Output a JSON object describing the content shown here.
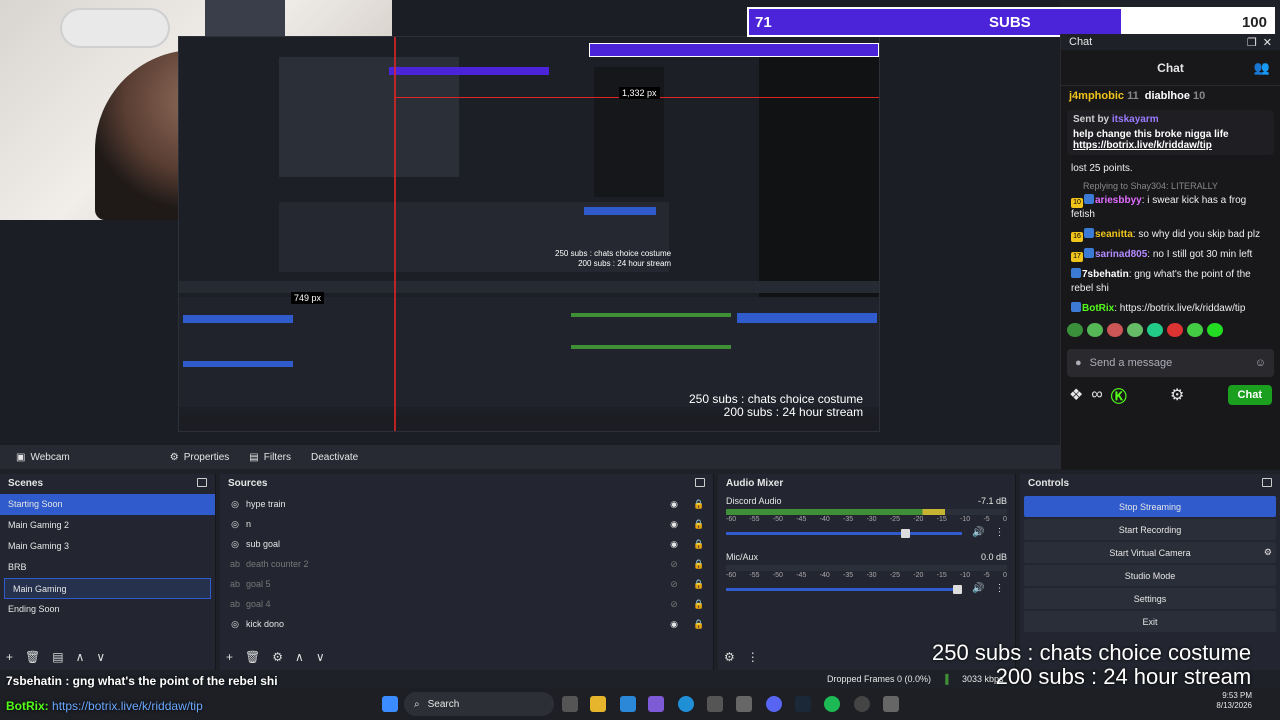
{
  "subs": {
    "current": "71",
    "label": "SUBS",
    "goal": "100",
    "progress": 0.71
  },
  "stream_text": {
    "line1": "250 subs : chats choice costume",
    "line2": "200 subs : 24 hour stream"
  },
  "nested": {
    "measure1": "1,332 px",
    "measure2": "749 px"
  },
  "chat": {
    "dock_title": "Chat",
    "header": "Chat",
    "top_users": [
      {
        "name": "j4mphobic",
        "count": "11"
      },
      {
        "name": "diablhoe",
        "count": "10"
      }
    ],
    "pinned": {
      "sent_by_prefix": "Sent by",
      "sent_by_user": "itskayarm",
      "message": "help change this broke nigga life",
      "link": "https://botrix.live/k/riddaw/tip"
    },
    "lost_points": "lost 25 points.",
    "reply_to": "Replying to Shay304: LITERALLY",
    "messages": [
      {
        "badge": "10",
        "user": "ariesbbyy",
        "color": "#e26dff",
        "text": "i swear kick has a frog fetish"
      },
      {
        "badge": "16",
        "user": "seanitta",
        "color": "#f0c41b",
        "text": "so why did you skip bad plz"
      },
      {
        "badge": "17",
        "user": "sarinad805",
        "color": "#b48bff",
        "text": "no I still got 30 min left"
      },
      {
        "badge": "",
        "user": "7sbehatin",
        "color": "#ffffff",
        "text": "gng what's the point of the rebel shi"
      },
      {
        "badge": "",
        "user": "BotRix",
        "color": "#53fc18",
        "text": "https://botrix.live/k/riddaw/tip"
      }
    ],
    "input_placeholder": "Send a message",
    "chat_button": "Chat"
  },
  "source_bar": {
    "source": "Webcam",
    "properties": "Properties",
    "filters": "Filters",
    "deactivate": "Deactivate"
  },
  "scenes": {
    "title": "Scenes",
    "items": [
      "Starting Soon",
      "Main Gaming 2",
      "Main Gaming 3",
      "BRB",
      "Main Gaming",
      "Ending Soon"
    ]
  },
  "sources": {
    "title": "Sources",
    "items": [
      {
        "label": "hype train",
        "hidden": false
      },
      {
        "label": "n",
        "hidden": false
      },
      {
        "label": "sub goal",
        "hidden": false
      },
      {
        "label": "death counter 2",
        "hidden": true
      },
      {
        "label": "goal 5",
        "hidden": true
      },
      {
        "label": "goal 4",
        "hidden": true
      },
      {
        "label": "kick dono",
        "hidden": false
      }
    ]
  },
  "mixer": {
    "title": "Audio Mixer",
    "channels": [
      {
        "name": "Discord Audio",
        "db": "-7.1 dB",
        "level": 0.78,
        "volume": 0.78
      },
      {
        "name": "Mic/Aux",
        "db": "0.0 dB",
        "level": 0.0,
        "volume": 1.0
      }
    ],
    "scale": [
      "-60",
      "-55",
      "-50",
      "-45",
      "-40",
      "-35",
      "-30",
      "-25",
      "-20",
      "-15",
      "-10",
      "-5",
      "0"
    ]
  },
  "controls": {
    "title": "Controls",
    "buttons": [
      "Stop Streaming",
      "Start Recording",
      "Start Virtual Camera",
      "Studio Mode",
      "Settings",
      "Exit"
    ]
  },
  "status": {
    "dropped": "Dropped Frames 0 (0.0%)",
    "kbps": "3033 kbps"
  },
  "overlay_chat": {
    "line1": "7sbehatin : gng what's the point of the rebel shi",
    "line2_user": "BotRix:",
    "line2_link": "https://botrix.live/k/riddaw/tip"
  },
  "taskbar": {
    "search": "Search",
    "time": "9:53 PM",
    "date": "8/13/2026"
  },
  "colors": {
    "accent": "#2f5bcc",
    "subs": "#4b24d9",
    "kick_green": "#53fc18"
  }
}
